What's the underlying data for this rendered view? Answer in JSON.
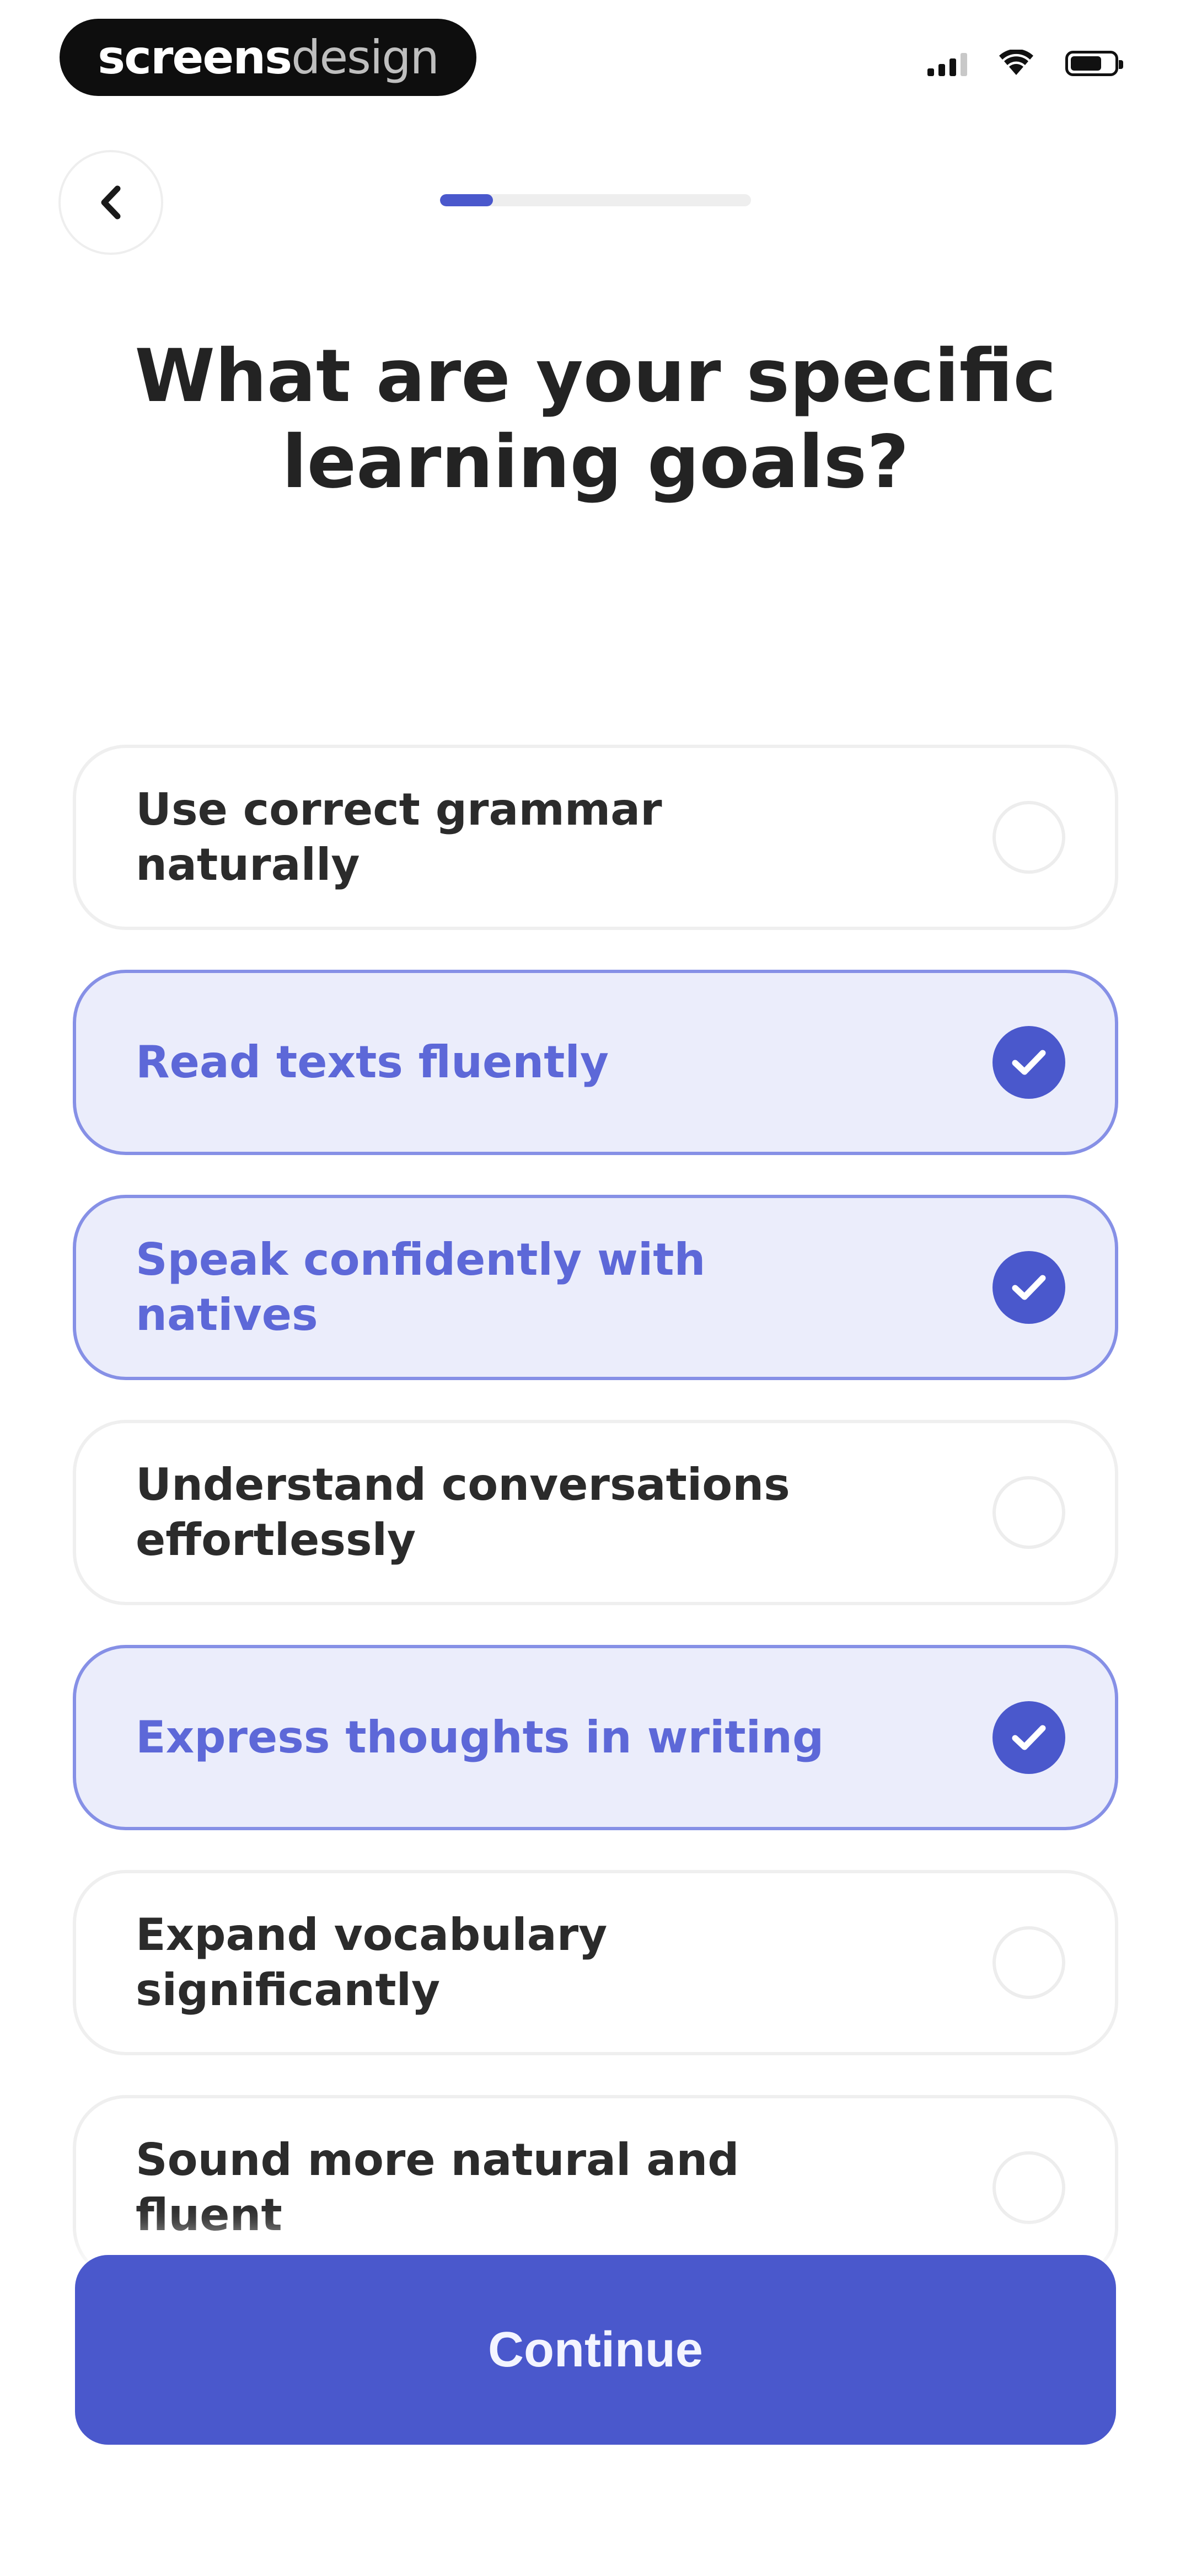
{
  "status_bar": {
    "brand_bold": "screens",
    "brand_light": "design",
    "signal_icon": "signal-icon",
    "wifi_icon": "wifi-icon",
    "battery_icon": "battery-icon"
  },
  "nav": {
    "back_icon": "chevron-left-icon",
    "progress_fraction": 0.17
  },
  "title": "What are your specific learning goals?",
  "options": [
    {
      "label": "Use correct grammar naturally",
      "selected": false
    },
    {
      "label": "Read texts fluently",
      "selected": true
    },
    {
      "label": "Speak confidently with natives",
      "selected": true
    },
    {
      "label": "Understand conversations effortlessly",
      "selected": false
    },
    {
      "label": "Express thoughts in writing",
      "selected": true
    },
    {
      "label": "Expand vocabulary significantly",
      "selected": false
    },
    {
      "label": "Sound more natural and fluent",
      "selected": false
    }
  ],
  "continue_label": "Continue",
  "colors": {
    "accent": "#4a58cc",
    "selected_bg": "#ebedfb",
    "selected_border": "#8690e6",
    "selected_text": "#5d68d8"
  }
}
